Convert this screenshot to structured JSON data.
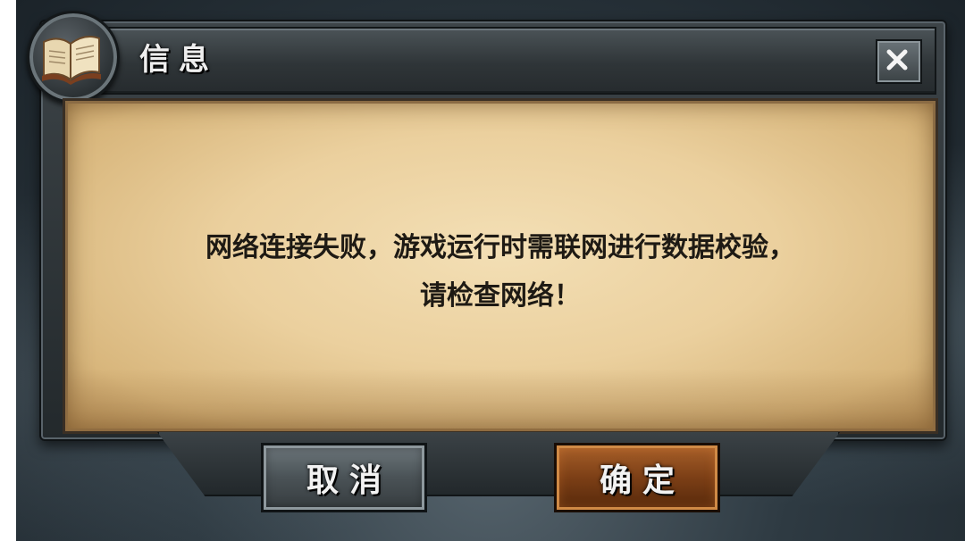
{
  "dialog": {
    "title": "信息",
    "message_line1": "网络连接失败，游戏运行时需联网进行数据校验，",
    "message_line2": "请检查网络！",
    "title_icon": "book-icon",
    "close_icon": "close-icon"
  },
  "buttons": {
    "cancel_label": "取消",
    "confirm_label": "确定"
  },
  "colors": {
    "parchment": "#ebd09e",
    "confirm_button": "#7c3f16",
    "cancel_button": "#4a5256",
    "frame": "#2f3538"
  }
}
